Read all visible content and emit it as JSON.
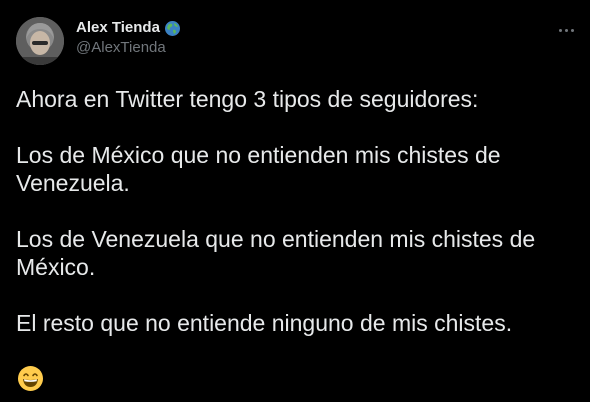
{
  "author": {
    "display_name": "Alex Tienda",
    "handle": "@AlexTienda",
    "badge_icon": "globe-icon"
  },
  "more_icon": "more-options-icon",
  "tweet": {
    "paragraphs": [
      "Ahora en Twitter tengo 3 tipos de seguidores:",
      "Los de México que no entienden mis chistes de Venezuela.",
      "Los de Venezuela que no entienden mis chistes de México.",
      "El resto que no entiende ninguno de mis chistes."
    ],
    "emoji": "grinning-face-with-smiling-eyes"
  },
  "colors": {
    "background": "#000000",
    "text": "#e7e9ea",
    "secondary_text": "#71767b"
  }
}
